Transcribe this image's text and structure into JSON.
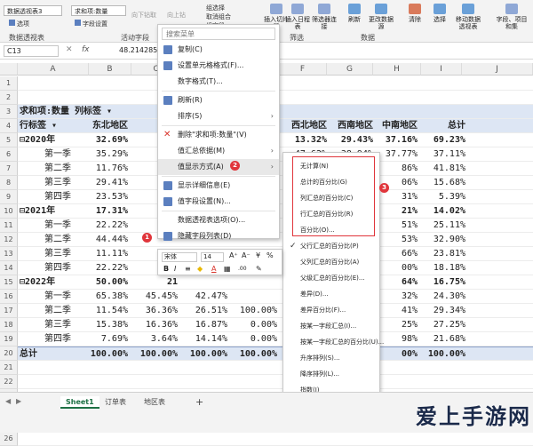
{
  "ribbon": {
    "pivot_name_box": "数据透视表3",
    "pivot_name_label": "数据透视表",
    "options_label": "选项",
    "active_field_box": "求和项:数量",
    "field_settings_label": "字段设置",
    "active_field_label": "活动字段",
    "drill_down": "向下钻取",
    "drill_up": "向上钻",
    "group_selection": "组选择",
    "ungroup": "取消组合",
    "group_field": "组字段",
    "insert_slicer": "插入切片器",
    "insert_timeline": "插入日程表",
    "filter_connections": "筛选器连接",
    "filter_group": "筛选",
    "refresh": "刷新",
    "change_source": "更改数据源",
    "data_group": "数据",
    "clear": "清除",
    "select": "选择",
    "move_pivot": "移动数据透视表",
    "fields_items": "字段、项目和集"
  },
  "formula_bar": {
    "cell_ref": "C13",
    "fx": "fx",
    "value": "48.214285"
  },
  "columns": [
    "A",
    "B",
    "C",
    "D",
    "E",
    "F",
    "G",
    "H",
    "I",
    "J"
  ],
  "rows": [
    {
      "num": "1",
      "cells": []
    },
    {
      "num": "2",
      "cells": []
    },
    {
      "num": "3",
      "cells": [
        "求和项:数量  列标签 ▾"
      ]
    },
    {
      "num": "4",
      "cells": [
        "行标签  ▾",
        "东北地区",
        "华北",
        "",
        "",
        "西北地区",
        "西南地区",
        "中南地区",
        "总计"
      ]
    },
    {
      "num": "5",
      "cells": [
        "⊟2020年",
        "32.69%",
        "56",
        "",
        "",
        "13.32%",
        "29.43%",
        "37.16%",
        "69.23%"
      ]
    },
    {
      "num": "6",
      "cells": [
        "第一季",
        "35.29%",
        "",
        "",
        "",
        "47.62%",
        "38.94%",
        "37.77%",
        "37.11%"
      ]
    },
    {
      "num": "7",
      "cells": [
        "第二季",
        "11.76%",
        "",
        "",
        "",
        "",
        "",
        "86%",
        "41.81%"
      ]
    },
    {
      "num": "8",
      "cells": [
        "第三季",
        "29.41%",
        "",
        "",
        "",
        "",
        "",
        "06%",
        "15.68%"
      ]
    },
    {
      "num": "9",
      "cells": [
        "第四季",
        "23.53%",
        "",
        "",
        "",
        "",
        "",
        "31%",
        "5.39%"
      ]
    },
    {
      "num": "10",
      "cells": [
        "⊟2021年",
        "17.31%",
        "21",
        "",
        "",
        "",
        "",
        "21%",
        "14.02%"
      ]
    },
    {
      "num": "11",
      "cells": [
        "第一季",
        "22.22%",
        "",
        "",
        "",
        "",
        "",
        "51%",
        "25.11%"
      ]
    },
    {
      "num": "12",
      "cells": [
        "第二季",
        "44.44%",
        "",
        "",
        "",
        "",
        "",
        "53%",
        "32.90%"
      ]
    },
    {
      "num": "13",
      "cells": [
        "第三季",
        "11.11%",
        "",
        "",
        "0.00%",
        "",
        "",
        "66%",
        "23.81%"
      ]
    },
    {
      "num": "14",
      "cells": [
        "第四季",
        "22.22%",
        "",
        "",
        "",
        "",
        "",
        "00%",
        "18.18%"
      ]
    },
    {
      "num": "15",
      "cells": [
        "⊟2022年",
        "50.00%",
        "21",
        "",
        "",
        "",
        "",
        "64%",
        "16.75%"
      ]
    },
    {
      "num": "16",
      "cells": [
        "第一季",
        "65.38%",
        "45.45%",
        "42.47%",
        "",
        "",
        "",
        "32%",
        "24.30%"
      ]
    },
    {
      "num": "17",
      "cells": [
        "第二季",
        "11.54%",
        "36.36%",
        "26.51%",
        "100.00%",
        "",
        "",
        "41%",
        "29.34%"
      ]
    },
    {
      "num": "18",
      "cells": [
        "第三季",
        "15.38%",
        "16.36%",
        "16.87%",
        "0.00%",
        "",
        "",
        "25%",
        "27.25%"
      ]
    },
    {
      "num": "19",
      "cells": [
        "第四季",
        "7.69%",
        "3.64%",
        "14.14%",
        "0.00%",
        "",
        "",
        "98%",
        "21.68%"
      ]
    },
    {
      "num": "20",
      "cells": [
        "总计",
        "100.00%",
        "100.00%",
        "100.00%",
        "100.00%",
        "",
        "",
        "00%",
        "100.00%"
      ]
    },
    {
      "num": "21",
      "cells": []
    },
    {
      "num": "22",
      "cells": []
    },
    {
      "num": "23",
      "cells": []
    },
    {
      "num": "24",
      "cells": []
    },
    {
      "num": "25",
      "cells": []
    },
    {
      "num": "26",
      "cells": []
    }
  ],
  "context_menu": {
    "search": "搜索菜单",
    "items": [
      {
        "label": "复制(C)",
        "icon": "copy-icon",
        "color": "#5b7fbf"
      },
      {
        "label": "设置单元格格式(F)...",
        "icon": "format-cells-icon",
        "color": "#5b7fbf"
      },
      {
        "label": "数字格式(T)...",
        "icon": "",
        "color": ""
      },
      {
        "label": "刷新(R)",
        "icon": "refresh-icon",
        "color": "#5b7fbf"
      },
      {
        "label": "排序(S)",
        "icon": "",
        "color": "",
        "sub": true
      },
      {
        "label": "删除\"求和项:数量\"(V)",
        "icon": "delete-icon",
        "color": "#d9342b"
      },
      {
        "label": "值汇总依据(M)",
        "icon": "",
        "color": "",
        "sub": true
      },
      {
        "label": "值显示方式(A)",
        "icon": "",
        "color": "",
        "sub": true,
        "highlight": true
      },
      {
        "label": "显示详细信息(E)",
        "icon": "details-icon",
        "color": "#5b7fbf"
      },
      {
        "label": "值字段设置(N)...",
        "icon": "field-settings-icon",
        "color": "#5b7fbf"
      },
      {
        "label": "数据透视表选项(O)...",
        "icon": "",
        "color": ""
      },
      {
        "label": "隐藏字段列表(D)",
        "icon": "field-list-icon",
        "color": "#5b7fbf"
      }
    ]
  },
  "submenu": {
    "items": [
      {
        "label": "无计算(N)",
        "check": false
      },
      {
        "label": "总计的百分比(G)",
        "check": false
      },
      {
        "label": "列汇总的百分比(C)",
        "check": false
      },
      {
        "label": "行汇总的百分比(R)",
        "check": false
      },
      {
        "label": "百分比(O)...",
        "check": false
      },
      {
        "label": "父行汇总的百分比(P)",
        "check": true
      },
      {
        "label": "父列汇总的百分比(A)",
        "check": false
      },
      {
        "label": "父级汇总的百分比(E)...",
        "check": false
      },
      {
        "label": "差异(D)...",
        "check": false
      },
      {
        "label": "差异百分比(F)...",
        "check": false
      },
      {
        "label": "按某一字段汇总(I)...",
        "check": false
      },
      {
        "label": "按某一字段汇总的百分比(U)...",
        "check": false
      },
      {
        "label": "升序排列(S)...",
        "check": false
      },
      {
        "label": "降序排列(L)...",
        "check": false
      },
      {
        "label": "指数(I)",
        "check": false
      },
      {
        "label": "其他选项(M)...",
        "check": false,
        "dim": true
      }
    ]
  },
  "mini_toolbar": {
    "font": "宋体",
    "size": "14",
    "bold": "B",
    "italic": "I"
  },
  "badges": [
    "1",
    "2",
    "3"
  ],
  "sheet_tabs": [
    "Sheet1",
    "订单表",
    "地区表",
    "+"
  ],
  "watermark": "爱上手游网",
  "colors": {
    "accent": "#e0353b",
    "header_fill": "#dde6f4",
    "excel_green": "#1e7145"
  }
}
